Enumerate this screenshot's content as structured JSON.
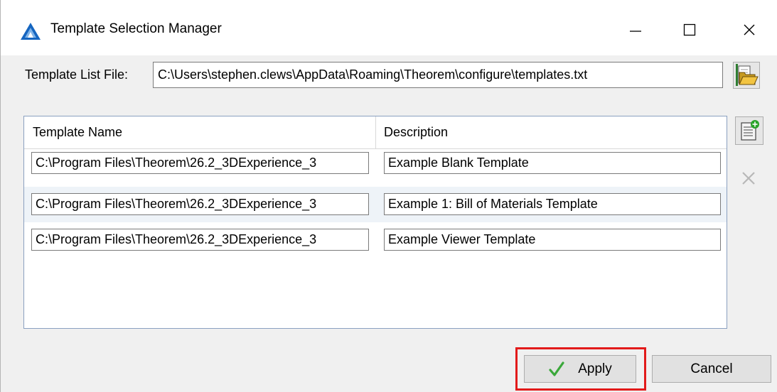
{
  "window": {
    "title": "Template Selection Manager",
    "minimize_glyph": "—",
    "close_glyph": "✕"
  },
  "template_list": {
    "label": "Template List File:",
    "path": "C:\\Users\\stephen.clews\\AppData\\Roaming\\Theorem\\configure\\templates.txt",
    "browse_icon": "folder-open-icon"
  },
  "grid": {
    "columns": [
      "Template Name",
      "Description"
    ],
    "rows": [
      {
        "name": "C:\\Program Files\\Theorem\\26.2_3DExperience_3",
        "description": "Example Blank Template"
      },
      {
        "name": "C:\\Program Files\\Theorem\\26.2_3DExperience_3",
        "description": "Example 1: Bill of Materials Template"
      },
      {
        "name": "C:\\Program Files\\Theorem\\26.2_3DExperience_3",
        "description": "Example Viewer Template"
      }
    ],
    "add_icon": "add-template-icon",
    "remove_icon": "remove-icon"
  },
  "buttons": {
    "apply": "Apply",
    "cancel": "Cancel"
  },
  "colors": {
    "highlight": "#e21a1a",
    "app_icon": "#1565c0",
    "check": "#3aa83a"
  }
}
